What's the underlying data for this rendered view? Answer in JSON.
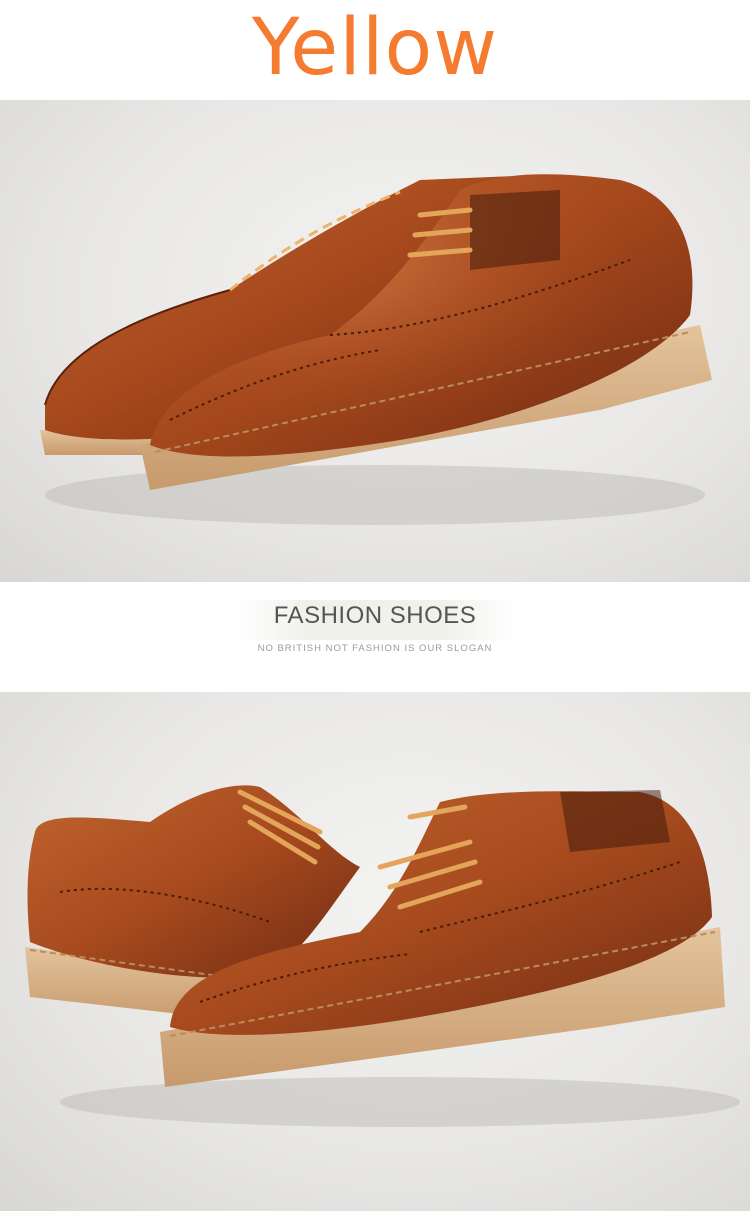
{
  "color_label": "Yellow",
  "banner": {
    "heading": "FASHION SHOES",
    "subheading": "NO BRITISH NOT FASHION IS OUR SLOGAN"
  },
  "photos": [
    {
      "subject": "pair-of-brown-brogue-oxford-shoes-front-view"
    },
    {
      "subject": "pair-of-brown-brogue-oxford-shoes-side-view"
    }
  ],
  "colors": {
    "title": "#f47b30",
    "leather": "#a4471c",
    "sole": "#d9b48a",
    "heading": "#555555",
    "subheading": "#9a9a9a"
  }
}
